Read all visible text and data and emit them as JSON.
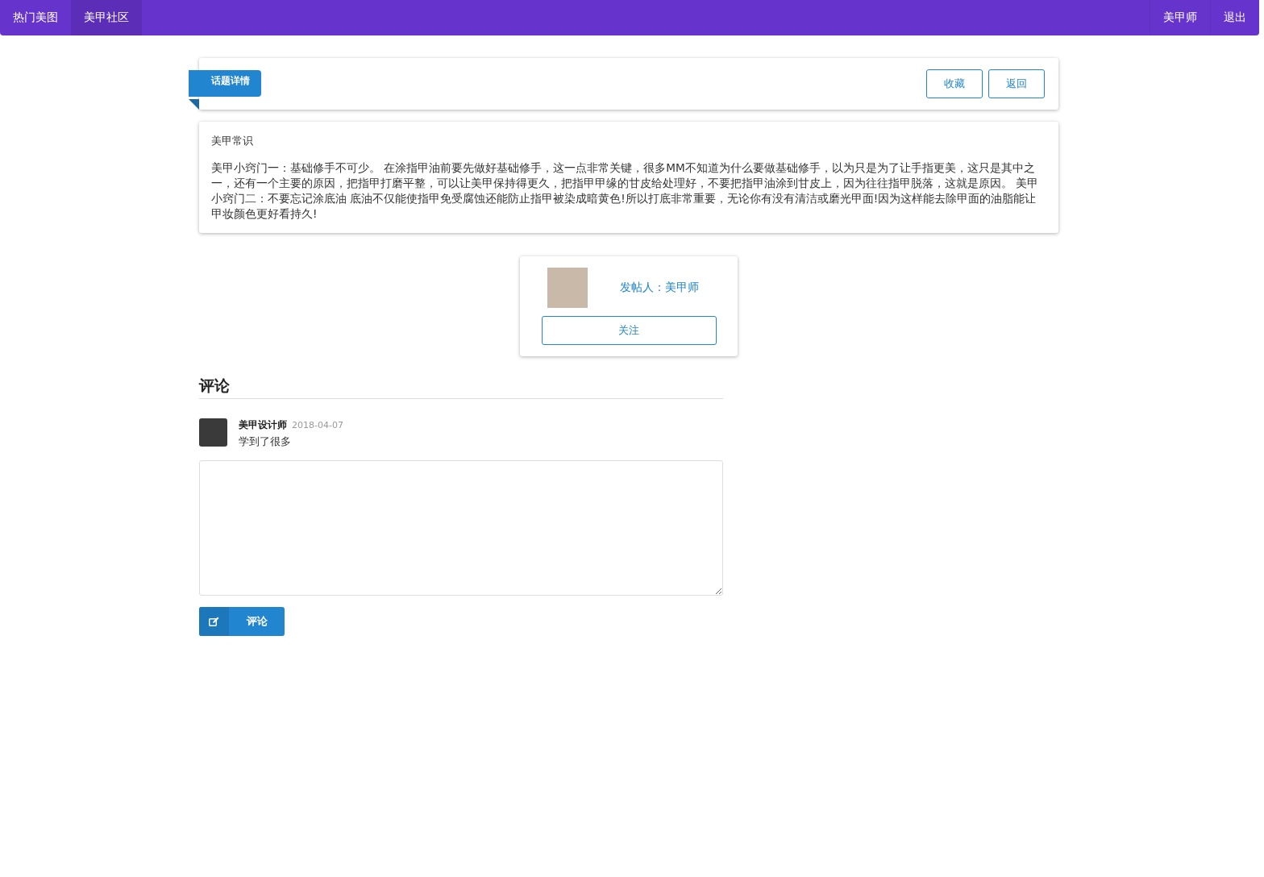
{
  "nav": {
    "left": [
      {
        "label": "热门美图",
        "selected": false
      },
      {
        "label": "美甲社区",
        "selected": true
      }
    ],
    "right": [
      {
        "label": "美甲师"
      },
      {
        "label": "退出"
      }
    ]
  },
  "topic_header": {
    "ribbon": "话题详情",
    "buttons": [
      "收藏",
      "返回"
    ]
  },
  "topic": {
    "title": "美甲常识",
    "body": "美甲小窍门一：基础修手不可少。 在涂指甲油前要先做好基础修手，这一点非常关键，很多MM不知道为什么要做基础修手，以为只是为了让手指更美，这只是其中之一，还有一个主要的原因，把指甲打磨平整，可以让美甲保持得更久，把指甲甲缘的甘皮给处理好，不要把指甲油涂到甘皮上，因为往往指甲脱落，这就是原因。 美甲小窍门二：不要忘记涂底油 底油不仅能使指甲免受腐蚀还能防止指甲被染成暗黄色!所以打底非常重要，无论你有没有清洁或磨光甲面!因为这样能去除甲面的油脂能让甲妆颜色更好看持久!"
  },
  "poster": {
    "label": "发帖人：美甲师",
    "follow_button": "关注"
  },
  "comments": {
    "heading": "评论",
    "items": [
      {
        "author": "美甲设计师",
        "date": "2018-04-07",
        "text": "学到了很多"
      }
    ],
    "submit_button": "评论"
  }
}
